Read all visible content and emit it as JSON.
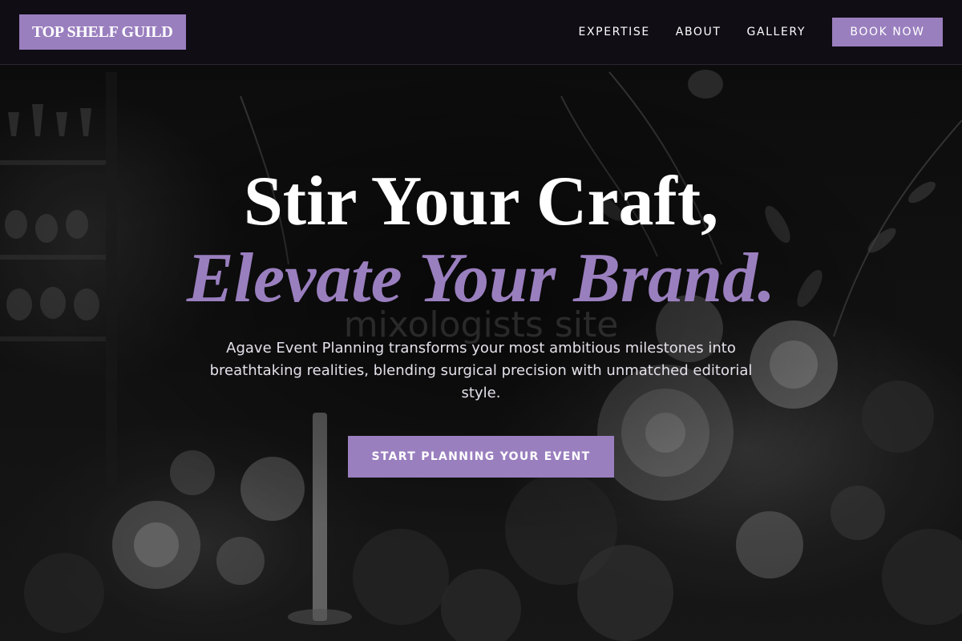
{
  "brand": {
    "logo_text": "TOP SHELF GUILD"
  },
  "nav": {
    "items": [
      {
        "label": "EXPERTISE"
      },
      {
        "label": "ABOUT"
      },
      {
        "label": "GALLERY"
      }
    ],
    "book_label": "BOOK NOW"
  },
  "hero": {
    "headline_line1": "Stir Your Craft,",
    "headline_line2": "Elevate Your Brand.",
    "watermark": "mixologists site",
    "subtitle": "Agave Event Planning transforms your most ambitious milestones into breathtaking realities, blending surgical precision with unmatched editorial style.",
    "cta_label": "START PLANNING YOUR EVENT",
    "background_image": "floral-bar-photo"
  },
  "colors": {
    "accent": "#9a7fbf",
    "header_bg": "#120e16",
    "text_light": "#ffffff"
  }
}
